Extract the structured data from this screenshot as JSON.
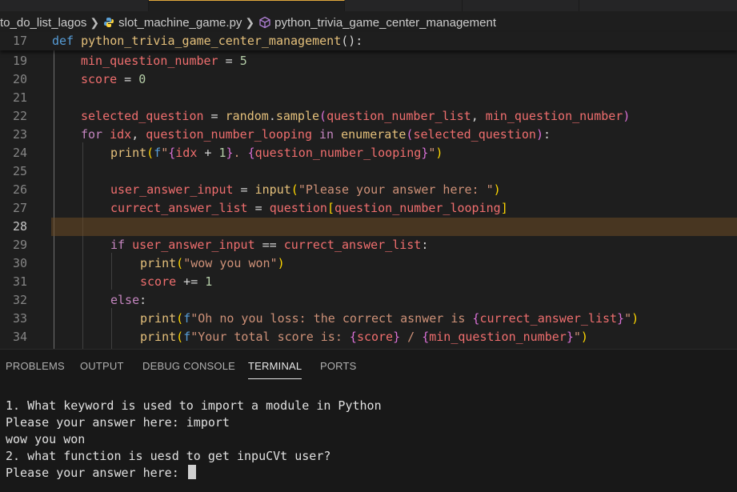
{
  "breadcrumb": {
    "folder": "to_do_list_lagos",
    "file": "slot_machine_game.py",
    "symbol": "python_trivia_game_center_management"
  },
  "editor": {
    "sticky_line": {
      "number": "17",
      "def_kw": "def",
      "name": "python_trivia_game_center_management",
      "tail": "():"
    },
    "line_numbers": [
      "19",
      "20",
      "21",
      "22",
      "23",
      "24",
      "25",
      "26",
      "27",
      "28",
      "29",
      "30",
      "31",
      "32",
      "33",
      "34"
    ],
    "code": {
      "l19": {
        "var": "min_question_number",
        "op": " = ",
        "num": "5"
      },
      "l20": {
        "var": "score",
        "op": " = ",
        "num": "0"
      },
      "l22": {
        "var": "selected_question",
        "op": " = ",
        "mod": "random",
        "dot": ".",
        "fn": "sample",
        "open": "(",
        "arg1": "question_number_list",
        "comma": ", ",
        "arg2": "min_question_number",
        "close": ")"
      },
      "l23": {
        "kw": "for",
        "v1": " idx",
        "comma": ",",
        "v2": " question_number_looping",
        "in": " in ",
        "fn": "enumerate",
        "open": "(",
        "arg": "selected_question",
        "close": ")",
        "colon": ":"
      },
      "l24": {
        "fn": "print",
        "open": "(",
        "f": "f",
        "q1": "\"",
        "b1": "{",
        "v1": "idx",
        "plus": " + ",
        "n1": "1",
        "b2": "}",
        "dot": ". ",
        "b3": "{",
        "v2": "question_number_looping",
        "b4": "}",
        "q2": "\"",
        "close": ")"
      },
      "l26": {
        "var": "user_answer_input",
        "op": " = ",
        "fn": "input",
        "open": "(",
        "str": "\"Please your answer here: \"",
        "close": ")"
      },
      "l27": {
        "var": "currect_answer_list",
        "op": " = ",
        "v2": "question",
        "open": "[",
        "arg": "question_number_looping",
        "close": "]"
      },
      "l29": {
        "kw": "if",
        "v1": " user_answer_input",
        "op": " == ",
        "v2": "currect_answer_list",
        "colon": ":"
      },
      "l30": {
        "fn": "print",
        "open": "(",
        "str": "\"wow you won\"",
        "close": ")"
      },
      "l31": {
        "var": "score",
        "op": " += ",
        "num": "1"
      },
      "l32": {
        "kw": "else",
        "colon": ":"
      },
      "l33": {
        "fn": "print",
        "open": "(",
        "f": "f",
        "str": "\"Oh no you loss: the correct asnwer is ",
        "b1": "{",
        "v": "currect_answer_list",
        "b2": "}",
        "q": "\"",
        "close": ")"
      },
      "l34": {
        "fn": "print",
        "open": "(",
        "f": "f",
        "str": "\"Your total score is: ",
        "b1": "{",
        "v1": "score",
        "b2": "}",
        "slash": " / ",
        "b3": "{",
        "v2": "min_question_number",
        "b4": "}",
        "q": "\"",
        "close": ")"
      }
    }
  },
  "panel": {
    "tabs": [
      "PROBLEMS",
      "OUTPUT",
      "DEBUG CONSOLE",
      "TERMINAL",
      "PORTS"
    ],
    "active_tab": "TERMINAL"
  },
  "terminal": {
    "lines": [
      "1. What keyword is used to import a module in Python",
      "Please your answer here: import",
      "wow you won",
      "2. what function is uesd to get inpuCVt user?",
      "Please your answer here: "
    ]
  },
  "colors": {
    "background": "#1e1e1e",
    "keyword": "#569cd6",
    "control": "#c586c0",
    "variable": "#ef6e6e",
    "function": "#e5c07b",
    "string": "#ce9178",
    "number": "#b5cea8",
    "current_line_highlight": "#6b4a24"
  }
}
